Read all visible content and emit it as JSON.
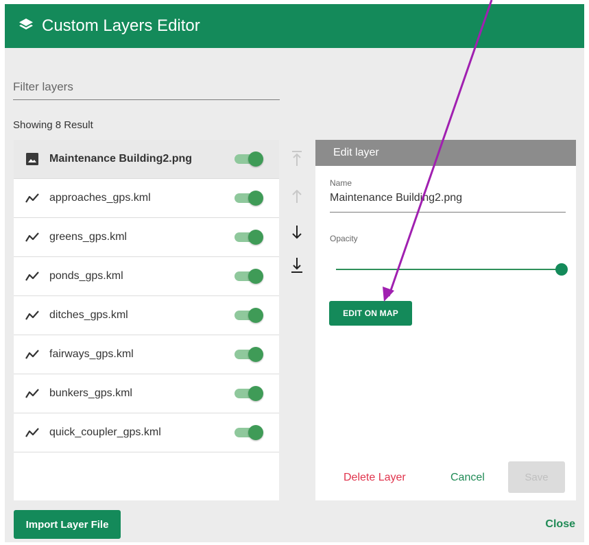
{
  "header": {
    "title": "Custom Layers Editor",
    "icon": "layers-icon"
  },
  "filter": {
    "placeholder": "Filter layers",
    "value": ""
  },
  "results": {
    "label": "Showing 8 Result"
  },
  "layers": [
    {
      "label": "Maintenance Building2.png",
      "icon": "image-icon",
      "enabled": true,
      "selected": true
    },
    {
      "label": "approaches_gps.kml",
      "icon": "polyline-icon",
      "enabled": true,
      "selected": false
    },
    {
      "label": "greens_gps.kml",
      "icon": "polyline-icon",
      "enabled": true,
      "selected": false
    },
    {
      "label": "ponds_gps.kml",
      "icon": "polyline-icon",
      "enabled": true,
      "selected": false
    },
    {
      "label": "ditches_gps.kml",
      "icon": "polyline-icon",
      "enabled": true,
      "selected": false
    },
    {
      "label": "fairways_gps.kml",
      "icon": "polyline-icon",
      "enabled": true,
      "selected": false
    },
    {
      "label": "bunkers_gps.kml",
      "icon": "polyline-icon",
      "enabled": true,
      "selected": false
    },
    {
      "label": "quick_coupler_gps.kml",
      "icon": "polyline-icon",
      "enabled": true,
      "selected": false
    }
  ],
  "reorder": {
    "move_top": {
      "icon": "move-to-top-icon",
      "enabled": false
    },
    "move_up": {
      "icon": "arrow-up-icon",
      "enabled": false
    },
    "move_down": {
      "icon": "arrow-down-icon",
      "enabled": true
    },
    "move_bottom": {
      "icon": "move-to-bottom-icon",
      "enabled": true
    }
  },
  "edit": {
    "header": "Edit layer",
    "name_label": "Name",
    "name_value": "Maintenance Building2.png",
    "opacity_label": "Opacity",
    "opacity": 1.0,
    "edit_on_map": "EDIT ON MAP",
    "delete": "Delete Layer",
    "cancel": "Cancel",
    "save": "Save"
  },
  "footer": {
    "import": "Import Layer File",
    "close": "Close"
  },
  "colors": {
    "primary": "#148a5a",
    "danger": "#e0334c",
    "annotation_arrow": "#a020b0",
    "panel_header": "#8c8c8c"
  }
}
